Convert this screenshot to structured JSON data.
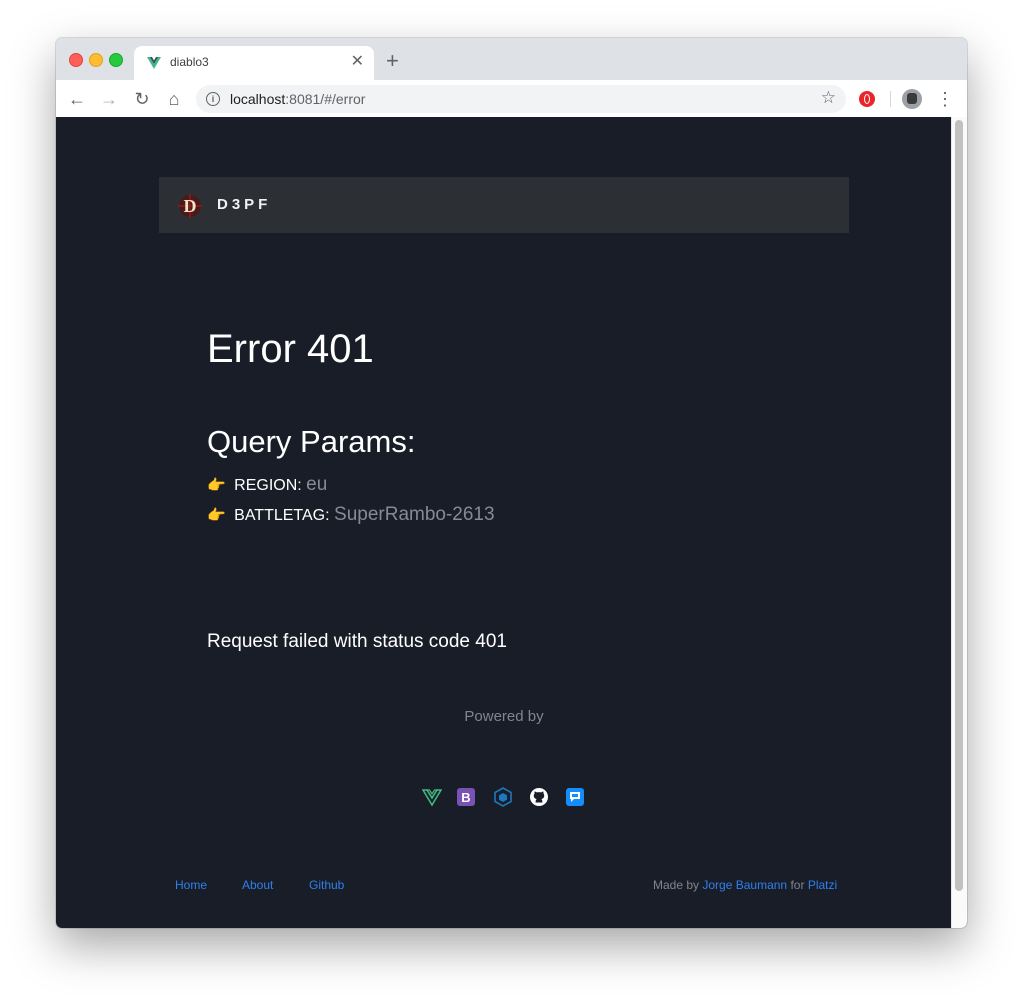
{
  "browser": {
    "tab_title": "diablo3",
    "url_host": "localhost",
    "url_rest": ":8081/#/error",
    "new_tab_icon": "plus-icon",
    "tab_close_icon": "close-icon"
  },
  "navbar": {
    "brand": "D3PF",
    "logo_letter": "D"
  },
  "page": {
    "error_title": "Error 401",
    "query_params_title": "Query Params:",
    "params": [
      {
        "label": "REGION:",
        "value": "eu",
        "icon": "pointing-hand-icon"
      },
      {
        "label": "BATTLETAG:",
        "value": "SuperRambo-2613",
        "icon": "pointing-hand-icon"
      }
    ],
    "request_message": "Request failed with status code 401",
    "powered_by": "Powered by",
    "tech_icons": [
      "vue-icon",
      "bootstrap-icon",
      "webpack-icon",
      "github-icon",
      "blizzard-icon"
    ]
  },
  "footer": {
    "links": [
      "Home",
      "About",
      "Github"
    ],
    "made_by_prefix": "Made by",
    "author": "Jorge Baumann",
    "for_text": "for",
    "org": "Platzi"
  },
  "colors": {
    "page_bg": "#181d27",
    "navbar_bg": "#2c2f34",
    "link": "#2f80ed",
    "muted": "#80858e"
  }
}
